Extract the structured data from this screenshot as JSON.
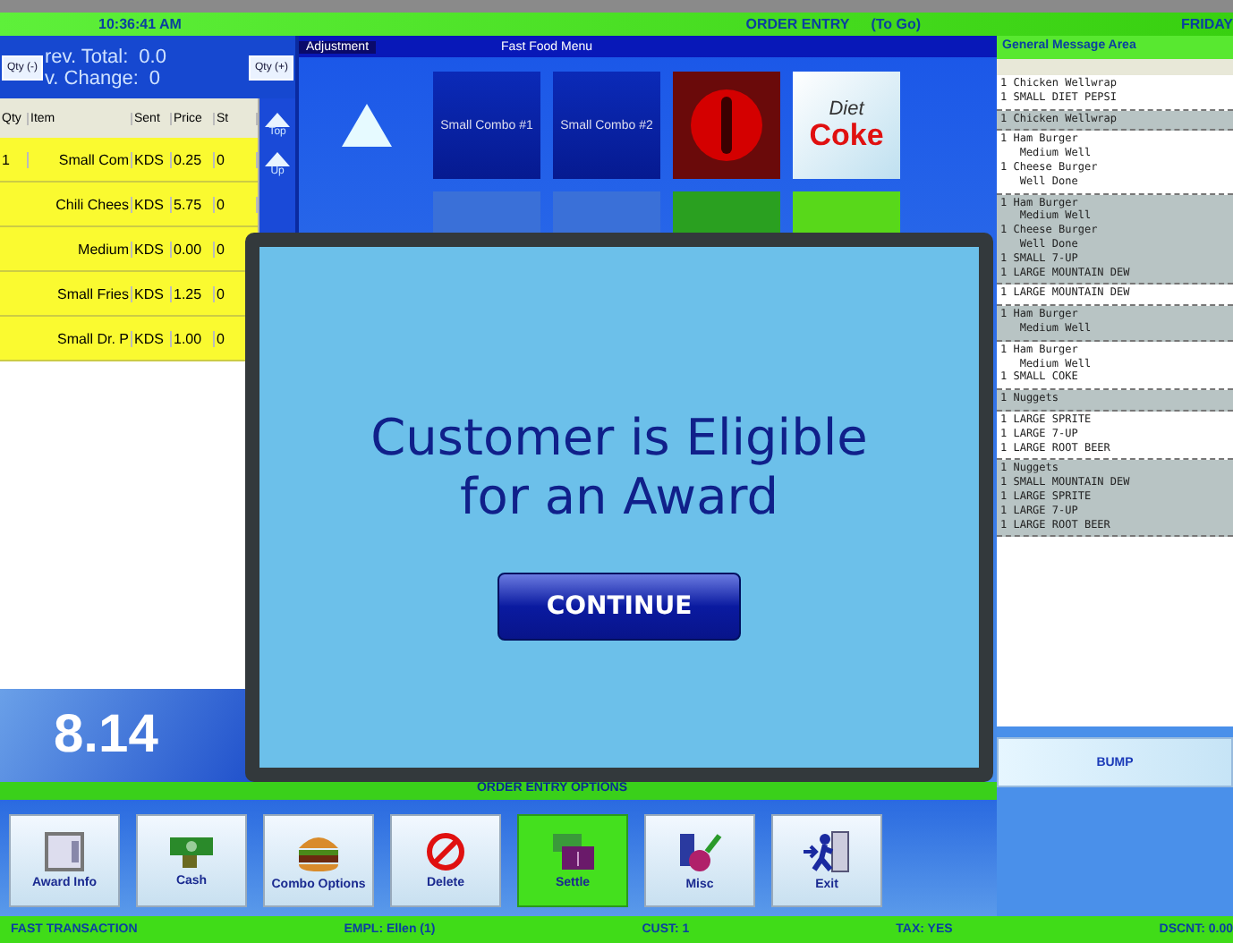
{
  "top_bar": {
    "time": "10:36:41 AM",
    "title": "ORDER ENTRY",
    "mode": "(To Go)",
    "day": "FRIDAY"
  },
  "totals": {
    "qty_minus": "Qty (-)",
    "qty_plus": "Qty (+)",
    "prev_total_label": "rev. Total:",
    "prev_total": "0.0",
    "prev_change_label": "v. Change:",
    "prev_change": "0"
  },
  "order_table": {
    "columns": [
      "Qty",
      "Item",
      "Sent",
      "Price",
      "St"
    ],
    "rows": [
      {
        "cells": [
          "1",
          "Small Com",
          "KDS",
          "0.25",
          "0"
        ]
      },
      {
        "cells": [
          "",
          "Chili Chees",
          "KDS",
          "5.75",
          "0"
        ]
      },
      {
        "cells": [
          "",
          "Medium",
          "KDS",
          "0.00",
          "0"
        ]
      },
      {
        "cells": [
          "",
          "Small Fries",
          "KDS",
          "1.25",
          "0"
        ]
      },
      {
        "cells": [
          "",
          "Small Dr. P",
          "KDS",
          "1.00",
          "0"
        ]
      }
    ]
  },
  "scroll_buttons": [
    "Top",
    "Up"
  ],
  "order_total": "8.14",
  "menu": {
    "tag": "Adjustment",
    "title": "Fast Food Menu",
    "tiles": [
      {
        "kind": "arrow"
      },
      {
        "kind": "combo",
        "label": "Small Combo #1"
      },
      {
        "kind": "combo",
        "label": "Small Combo #2"
      },
      {
        "kind": "cola"
      },
      {
        "kind": "diet",
        "label": "Diet",
        "label2": "Coke"
      },
      {
        "kind": "blank"
      },
      {
        "kind": "combo2"
      },
      {
        "kind": "combo2"
      },
      {
        "kind": "soda"
      },
      {
        "kind": "lemon"
      }
    ]
  },
  "messages": {
    "title": "General Message Area",
    "groups": [
      {
        "shaded": false,
        "lines": [
          "1 Chicken Wellwrap",
          "1 SMALL DIET PEPSI"
        ]
      },
      {
        "shaded": true,
        "lines": [
          "1 Chicken Wellwrap"
        ]
      },
      {
        "shaded": false,
        "lines": [
          "1 Ham Burger",
          "   Medium Well",
          "1 Cheese Burger",
          "   Well Done"
        ]
      },
      {
        "shaded": true,
        "lines": [
          "1 Ham Burger",
          "   Medium Well",
          "1 Cheese Burger",
          "   Well Done",
          "1 SMALL 7-UP",
          "1 LARGE MOUNTAIN DEW"
        ]
      },
      {
        "shaded": false,
        "lines": [
          "1 LARGE MOUNTAIN DEW"
        ]
      },
      {
        "shaded": true,
        "lines": [
          "1 Ham Burger",
          "   Medium Well"
        ]
      },
      {
        "shaded": false,
        "lines": [
          "1 Ham Burger",
          "   Medium Well",
          "1 SMALL COKE"
        ]
      },
      {
        "shaded": true,
        "lines": [
          "1 Nuggets"
        ]
      },
      {
        "shaded": false,
        "lines": [
          "1 LARGE SPRITE",
          "1 LARGE 7-UP",
          "1 LARGE ROOT BEER"
        ]
      },
      {
        "shaded": true,
        "lines": [
          "1 Nuggets",
          "1 SMALL MOUNTAIN DEW",
          "1 LARGE SPRITE",
          "1 LARGE 7-UP",
          "1 LARGE ROOT BEER"
        ]
      }
    ],
    "bump": "BUMP"
  },
  "options_title": "ORDER ENTRY OPTIONS",
  "actions": [
    {
      "kind": "award",
      "label": "Award Info",
      "selected": false
    },
    {
      "kind": "cash",
      "label": "Cash",
      "selected": false
    },
    {
      "kind": "combo",
      "label": "Combo Options",
      "selected": false
    },
    {
      "kind": "delete",
      "label": "Delete",
      "selected": false
    },
    {
      "kind": "settle",
      "label": "Settle",
      "selected": true
    },
    {
      "kind": "misc",
      "label": "Misc",
      "selected": false
    },
    {
      "kind": "exit",
      "label": "Exit",
      "selected": false
    }
  ],
  "status_bar": [
    "FAST TRANSACTION",
    "EMPL: Ellen (1)",
    "CUST: 1",
    "TAX: YES",
    "DSCNT: 0.00"
  ],
  "dialog": {
    "message_line1": "Customer is Eligible",
    "message_line2": "for an Award",
    "button": "CONTINUE"
  }
}
